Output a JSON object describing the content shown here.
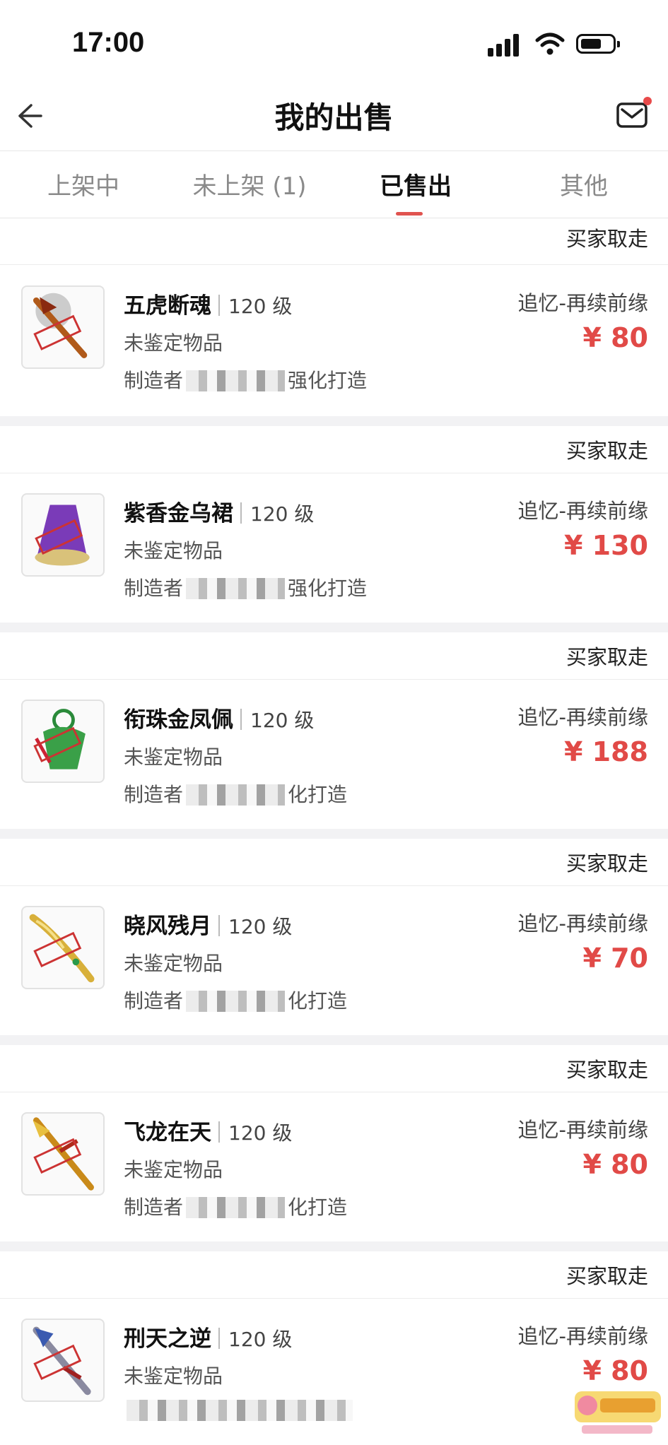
{
  "status": {
    "time": "17:00"
  },
  "nav": {
    "title": "我的出售"
  },
  "tabs": [
    {
      "label": "上架中"
    },
    {
      "label": "未上架 (1)"
    },
    {
      "label": "已售出"
    },
    {
      "label": "其他"
    }
  ],
  "orders": [
    {
      "status": "买家取走",
      "name": "五虎断魂",
      "level": "120 级",
      "note": "未鉴定物品",
      "maker_prefix": "制造者",
      "maker_suffix": "强化打造",
      "server": "追忆-再续前缘",
      "price": "¥ 80"
    },
    {
      "status": "买家取走",
      "name": "紫香金乌裙",
      "level": "120 级",
      "note": "未鉴定物品",
      "maker_prefix": "制造者",
      "maker_suffix": "强化打造",
      "server": "追忆-再续前缘",
      "price": "¥ 130"
    },
    {
      "status": "买家取走",
      "name": "衔珠金凤佩",
      "level": "120 级",
      "note": "未鉴定物品",
      "maker_prefix": "制造者",
      "maker_suffix": "化打造",
      "server": "追忆-再续前缘",
      "price": "¥ 188"
    },
    {
      "status": "买家取走",
      "name": "晓风残月",
      "level": "120 级",
      "note": "未鉴定物品",
      "maker_prefix": "制造者",
      "maker_suffix": "化打造",
      "server": "追忆-再续前缘",
      "price": "¥ 70"
    },
    {
      "status": "买家取走",
      "name": "飞龙在天",
      "level": "120 级",
      "note": "未鉴定物品",
      "maker_prefix": "制造者",
      "maker_suffix": "化打造",
      "server": "追忆-再续前缘",
      "price": "¥ 80"
    },
    {
      "status": "买家取走",
      "name": "刑天之逆",
      "level": "120 级",
      "note": "未鉴定物品",
      "maker_prefix": "",
      "maker_suffix": "",
      "server": "追忆-再续前缘",
      "price": "¥ 80"
    }
  ],
  "colors": {
    "accent": "#e14a47",
    "tab_indicator": "#e0534f"
  },
  "icons": [
    "back-arrow-icon",
    "mail-icon",
    "signal-icon",
    "wifi-icon",
    "battery-icon"
  ]
}
